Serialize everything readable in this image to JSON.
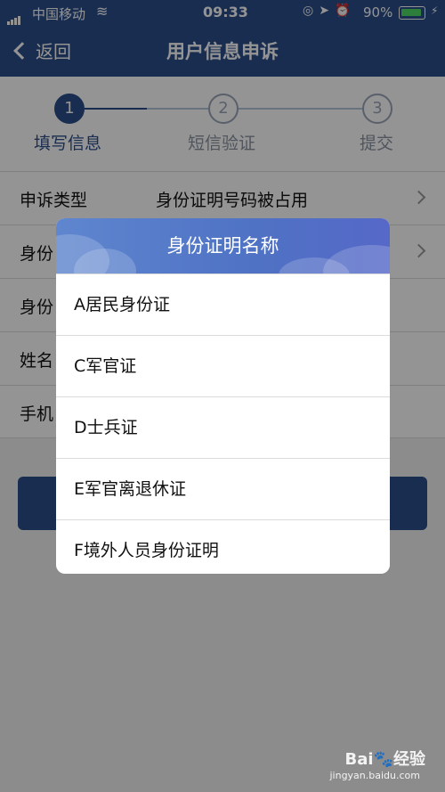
{
  "status_bar": {
    "carrier": "中国移动",
    "time": "09:33",
    "battery": "90%",
    "battery_level": 0.9
  },
  "nav": {
    "back_label": "返回",
    "title": "用户信息申诉"
  },
  "steps": [
    {
      "number": "1",
      "label": "填写信息",
      "active": true
    },
    {
      "number": "2",
      "label": "短信验证",
      "active": false
    },
    {
      "number": "3",
      "label": "提交",
      "active": false
    }
  ],
  "form": {
    "rows": [
      {
        "label": "申诉类型",
        "value": "身份证明号码被占用"
      },
      {
        "label": "身份"
      },
      {
        "label": "身份"
      },
      {
        "label": "姓名"
      },
      {
        "label": "手机"
      }
    ]
  },
  "dialog": {
    "title": "身份证明名称",
    "options": [
      "A居民身份证",
      "C军官证",
      "D士兵证",
      "E军官离退休证",
      "F境外人员身份证明"
    ]
  },
  "watermark": {
    "brand": "Bai🐾经验",
    "url": "jingyan.baidu.com"
  },
  "colors": {
    "primary": "#2b4f8c",
    "dialog_header": "#4f72c4"
  }
}
